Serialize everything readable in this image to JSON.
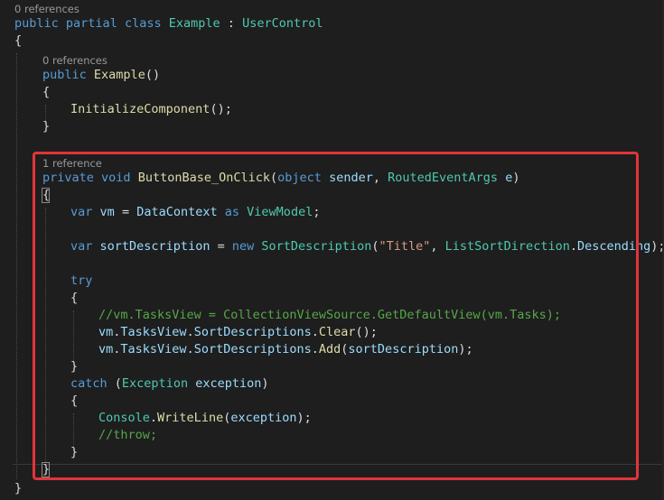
{
  "codelens": {
    "class_refs": "0 references",
    "ctor_refs": "0 references",
    "method_refs": "1 reference"
  },
  "code": {
    "l1": [
      "public",
      "partial",
      "class",
      "Example",
      ":",
      "UserControl"
    ],
    "l2": "{",
    "l3": [
      "public",
      "Example",
      "()"
    ],
    "l4": "{",
    "l5": [
      "InitializeComponent",
      "();"
    ],
    "l6": "}",
    "l7": [
      "private",
      "void",
      "ButtonBase_OnClick",
      "(",
      "object",
      "sender",
      ",",
      "RoutedEventArgs",
      "e",
      ")"
    ],
    "l8": "{",
    "l9": [
      "var",
      "vm",
      "=",
      "DataContext",
      "as",
      "ViewModel",
      ";"
    ],
    "l10": [
      "var",
      "sortDescription",
      "=",
      "new",
      "SortDescription",
      "(",
      "\"Title\"",
      ",",
      "ListSortDirection",
      ".",
      "Descending",
      ");"
    ],
    "l11": "try",
    "l12": "{",
    "l13": "//vm.TasksView = CollectionViewSource.GetDefaultView(vm.Tasks);",
    "l14": [
      "vm",
      ".",
      "TasksView",
      ".",
      "SortDescriptions",
      ".",
      "Clear",
      "();"
    ],
    "l15": [
      "vm",
      ".",
      "TasksView",
      ".",
      "SortDescriptions",
      ".",
      "Add",
      "(",
      "sortDescription",
      ");"
    ],
    "l16": "}",
    "l17": [
      "catch",
      "(",
      "Exception",
      "exception",
      ")"
    ],
    "l18": "{",
    "l19": [
      "Console",
      ".",
      "WriteLine",
      "(",
      "exception",
      ");"
    ],
    "l20": "//throw;",
    "l21": "}",
    "l22": "}",
    "l23": "}"
  },
  "colors": {
    "background": "#1e1e1e",
    "keyword": "#569cd6",
    "type": "#4ec9b0",
    "method": "#dcdcaa",
    "identifier": "#9cdcfe",
    "string": "#d69d85",
    "comment": "#57a64a",
    "highlight_border": "#e2343a"
  }
}
